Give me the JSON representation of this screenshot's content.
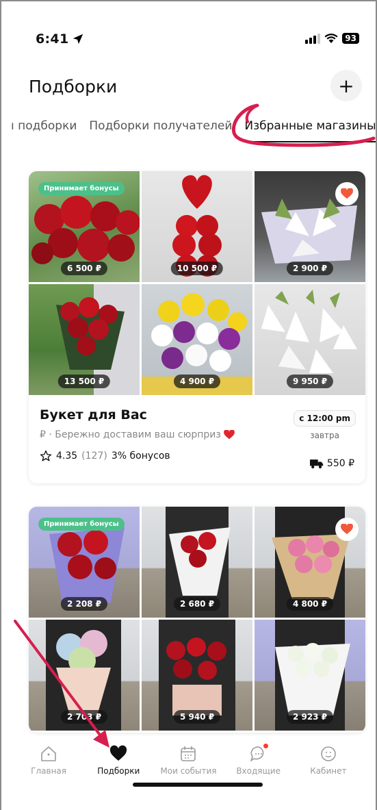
{
  "status_bar": {
    "time": "6:41",
    "battery": "93"
  },
  "header": {
    "title": "Подборки",
    "add_label": "+"
  },
  "tabs": [
    {
      "label": "ı подборки"
    },
    {
      "label": "Подборки получателей"
    },
    {
      "label": "Избранные магазины"
    }
  ],
  "colors": {
    "accent": "#4cc08a",
    "favorite": "#f05a3a",
    "annotation": "#d61f4e"
  },
  "shops": [
    {
      "name": "Букет для Вас",
      "description": "₽ · Бережно доставим ваш сюрприз",
      "rating": "4.35",
      "reviews": "(127)",
      "bonus": "3% бонусов",
      "delivery_time": "с 12:00 pm",
      "delivery_day": "завтра",
      "delivery_price": "550 ₽",
      "bonus_badge": "Принимает бонусы",
      "prices": [
        "6 500 ₽",
        "10 500 ₽",
        "2 900 ₽",
        "13 500 ₽",
        "4 900 ₽",
        "9 950 ₽"
      ]
    },
    {
      "bonus_badge": "Принимает бонусы",
      "prices": [
        "2 208 ₽",
        "2 680 ₽",
        "4 800 ₽",
        "2 703 ₽",
        "5 940 ₽",
        "2 923 ₽"
      ]
    }
  ],
  "nav": [
    {
      "label": "Главная",
      "icon": "home-icon"
    },
    {
      "label": "Подборки",
      "icon": "heart-icon"
    },
    {
      "label": "Мои события",
      "icon": "calendar-icon"
    },
    {
      "label": "Входящие",
      "icon": "chat-icon"
    },
    {
      "label": "Кабинет",
      "icon": "profile-icon"
    }
  ]
}
